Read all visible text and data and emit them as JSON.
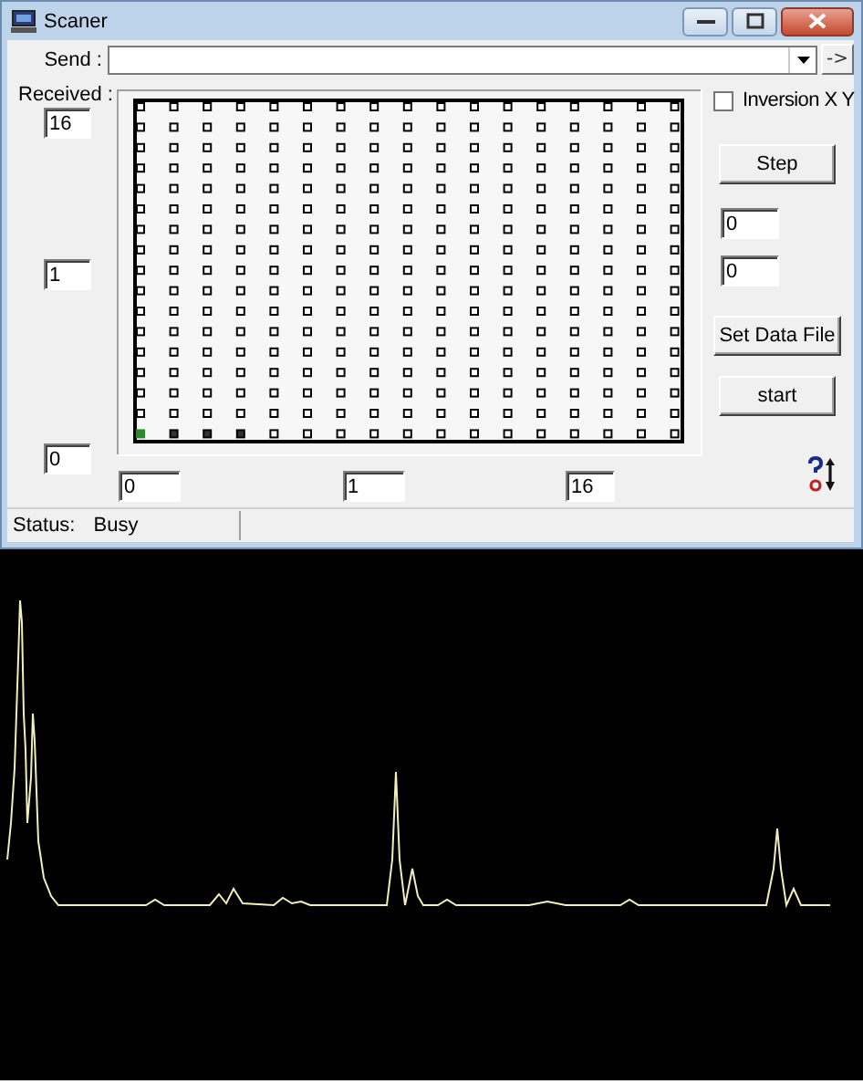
{
  "window": {
    "title": "Scaner"
  },
  "send": {
    "label": "Send :",
    "button": "->"
  },
  "received": {
    "label": "Received :",
    "fields": [
      "16",
      "1",
      "0"
    ]
  },
  "x_fields": [
    "0",
    "1",
    "16"
  ],
  "inversion": {
    "label": "Inversion X Y",
    "checked": false
  },
  "step_button": "Step",
  "right_fields": [
    "0",
    "0"
  ],
  "buttons": [
    "Set Data File",
    "start"
  ],
  "status_bar": {
    "label": "Status:",
    "value": "Busy"
  }
}
